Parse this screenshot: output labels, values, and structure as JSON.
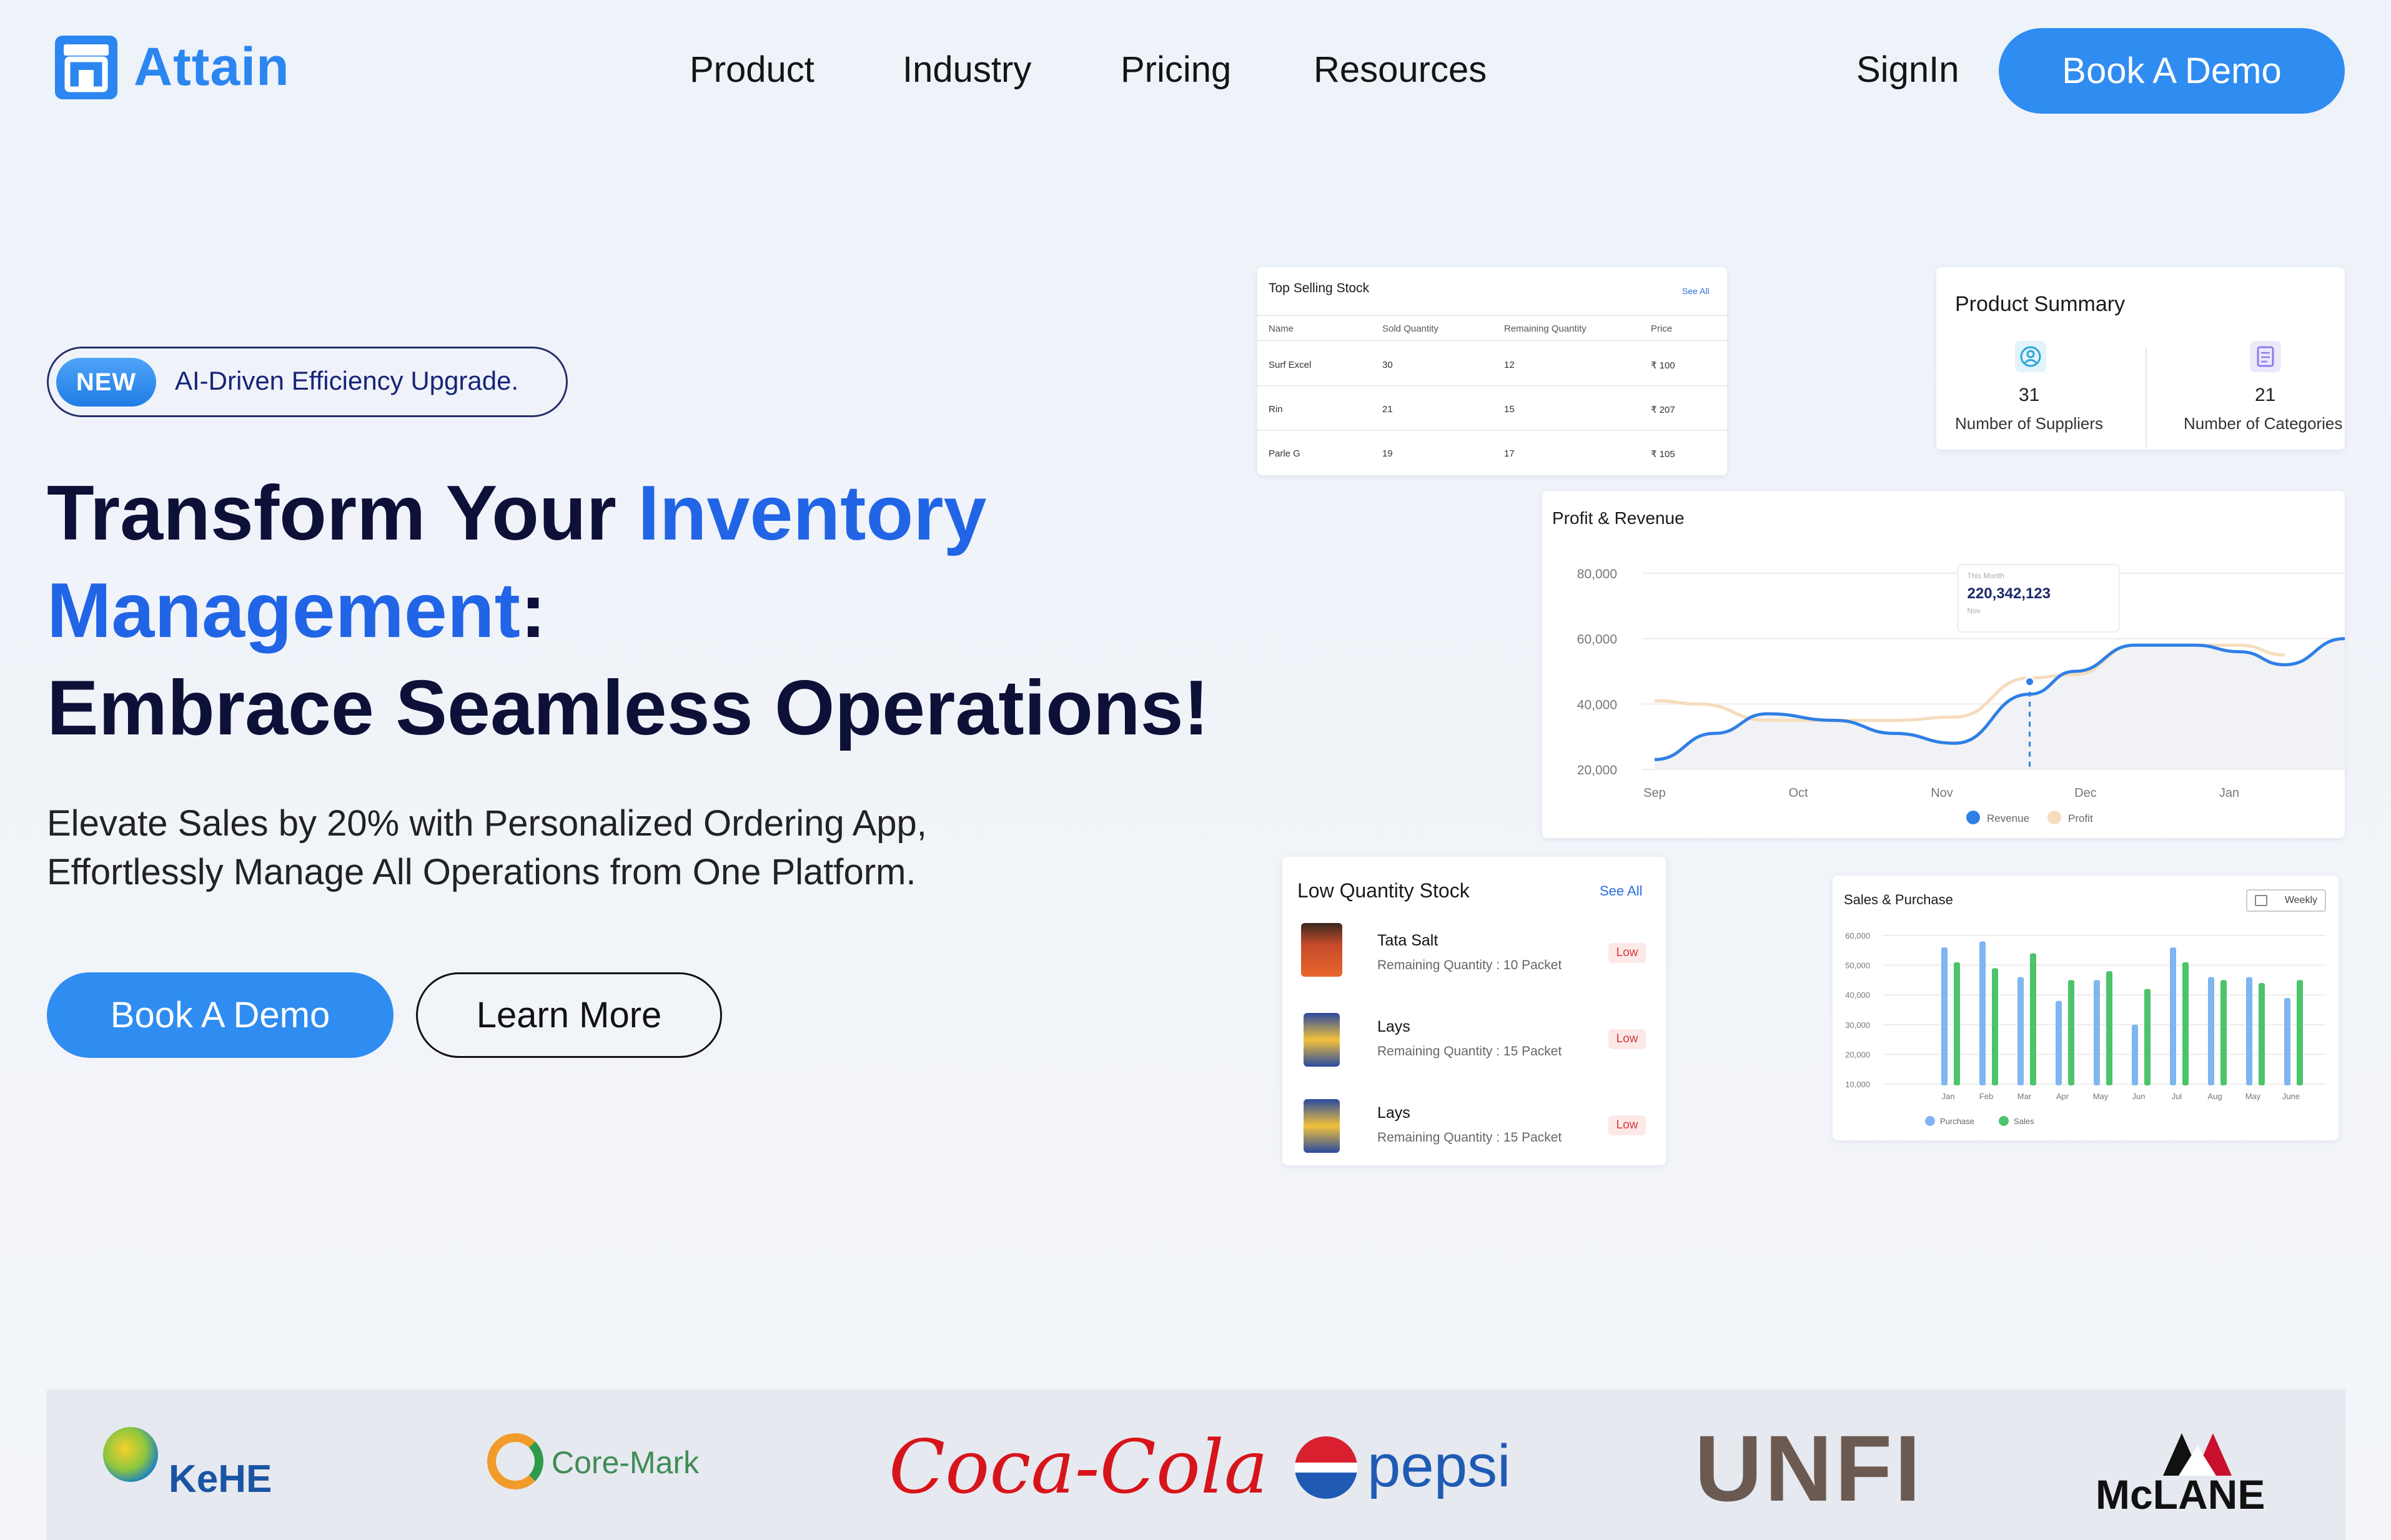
{
  "nav": {
    "brand": "Attain",
    "items": [
      "Product",
      "Industry",
      "Pricing",
      "Resources"
    ],
    "signin": "SignIn",
    "demo": "Book A Demo"
  },
  "hero": {
    "badge": "NEW",
    "badge_text": "AI-Driven Efficiency Upgrade.",
    "line1_a": "Transform Your ",
    "line1_b": "Inventory",
    "line2_a": "Management",
    "line2_b": ":",
    "line3": "Embrace Seamless Operations!",
    "sub1": "Elevate Sales by 20% with Personalized Ordering App,",
    "sub2": "Effortlessly Manage All Operations from One Platform.",
    "cta_primary": "Book A Demo",
    "cta_secondary": "Learn More"
  },
  "top_selling": {
    "title": "Top Selling Stock",
    "see_all": "See All",
    "headers": [
      "Name",
      "Sold Quantity",
      "Remaining Quantity",
      "Price"
    ],
    "rows": [
      [
        "Surf Excel",
        "30",
        "12",
        "₹ 100"
      ],
      [
        "Rin",
        "21",
        "15",
        "₹ 207"
      ],
      [
        "Parle G",
        "19",
        "17",
        "₹ 105"
      ]
    ]
  },
  "product_summary": {
    "title": "Product Summary",
    "items": [
      {
        "value": "31",
        "label": "Number of Suppliers",
        "icon": "user-circle-icon"
      },
      {
        "value": "21",
        "label": "Number of Categories",
        "icon": "clipboard-icon"
      }
    ]
  },
  "low_stock": {
    "title": "Low Quantity  Stock",
    "see_all": "See All",
    "items": [
      {
        "name": "Tata Salt",
        "sub": "Remaining Quantity : 10 Packet",
        "badge": "Low"
      },
      {
        "name": "Lays",
        "sub": "Remaining Quantity : 15 Packet",
        "badge": "Low"
      },
      {
        "name": "Lays",
        "sub": "Remaining Quantity : 15 Packet",
        "badge": "Low"
      }
    ]
  },
  "logos": [
    "KeHE",
    "Core-Mark",
    "Coca-Cola",
    "pepsi",
    "UNFI",
    "McLANE"
  ],
  "chart_data": [
    {
      "type": "line",
      "title": "Profit  & Revenue",
      "categories": [
        "Sep",
        "Oct",
        "Nov",
        "Dec",
        "Jan"
      ],
      "yticks": [
        "80,000",
        "60,000",
        "40,000",
        "20,000"
      ],
      "ylim": [
        20000,
        80000
      ],
      "tooltip": {
        "label": "This Month",
        "value": "220,342,123",
        "sub": "Nov"
      },
      "series": [
        {
          "name": "Revenue",
          "color": "#2f7fe6",
          "x": [
            0,
            0.4,
            0.75,
            1.2,
            1.6,
            2.0,
            2.5,
            2.8,
            3.2,
            3.6,
            3.9,
            4.2,
            4.6,
            4.9
          ],
          "values": [
            23000,
            31000,
            37000,
            35000,
            31000,
            28000,
            43000,
            50000,
            58000,
            58000,
            56000,
            52000,
            60000,
            65000
          ]
        },
        {
          "name": "Profit",
          "color": "#f5dcbc",
          "x": [
            0,
            0.3,
            0.75,
            1.2,
            1.6,
            2.0,
            2.5,
            2.8,
            3.2,
            3.6,
            3.9,
            4.2
          ],
          "values": [
            41000,
            40000,
            35000,
            35000,
            35000,
            36000,
            48000,
            49000,
            58000,
            58000,
            58000,
            55000
          ]
        }
      ],
      "legend": "bottom"
    },
    {
      "type": "bar",
      "title": "Sales & Purchase",
      "filter": "Weekly",
      "categories": [
        "Jan",
        "Feb",
        "Mar",
        "Apr",
        "May",
        "Jun",
        "Jul",
        "Aug",
        "May",
        "June"
      ],
      "yticks": [
        "60,000",
        "50,000",
        "40,000",
        "30,000",
        "20,000",
        "10,000"
      ],
      "ylim": [
        10000,
        60000
      ],
      "series": [
        {
          "name": "Purchase",
          "color": "#7fb5f0",
          "values": [
            56000,
            58000,
            46000,
            38000,
            45000,
            30000,
            56000,
            46000,
            46000,
            39000
          ]
        },
        {
          "name": "Sales",
          "color": "#4bc46a",
          "values": [
            51000,
            49000,
            54000,
            45000,
            48000,
            42000,
            51000,
            45000,
            44000,
            45000
          ]
        }
      ],
      "legend": "bottom-left"
    }
  ]
}
